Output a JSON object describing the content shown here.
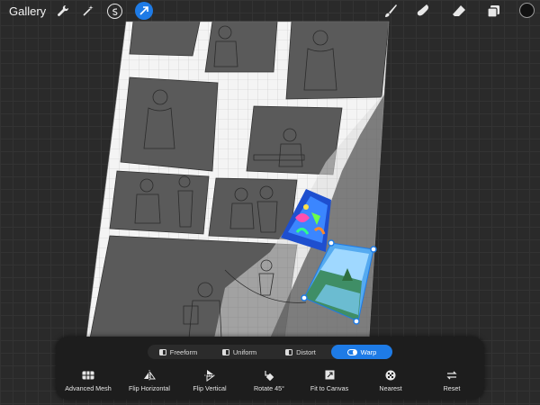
{
  "toolbar": {
    "gallery_label": "Gallery",
    "left_tools": [
      "wrench-icon",
      "magic-wand-icon",
      "selection-icon",
      "transform-icon"
    ],
    "right_tools": [
      "brush-icon",
      "smudge-icon",
      "eraser-icon",
      "layers-icon"
    ],
    "current_color": "#111111",
    "accent_color": "#1e7be6"
  },
  "transform": {
    "modes": [
      {
        "label": "Freeform",
        "active": false
      },
      {
        "label": "Uniform",
        "active": false
      },
      {
        "label": "Distort",
        "active": false
      },
      {
        "label": "Warp",
        "active": true
      }
    ],
    "actions": [
      {
        "label": "Advanced Mesh",
        "icon": "mesh-icon"
      },
      {
        "label": "Flip Horizontal",
        "icon": "flip-horizontal-icon"
      },
      {
        "label": "Flip Vertical",
        "icon": "flip-vertical-icon"
      },
      {
        "label": "Rotate 45°",
        "icon": "rotate-icon"
      },
      {
        "label": "Fit to Canvas",
        "icon": "fit-canvas-icon"
      },
      {
        "label": "Nearest",
        "icon": "nearest-icon"
      },
      {
        "label": "Reset",
        "icon": "reset-icon"
      }
    ]
  }
}
